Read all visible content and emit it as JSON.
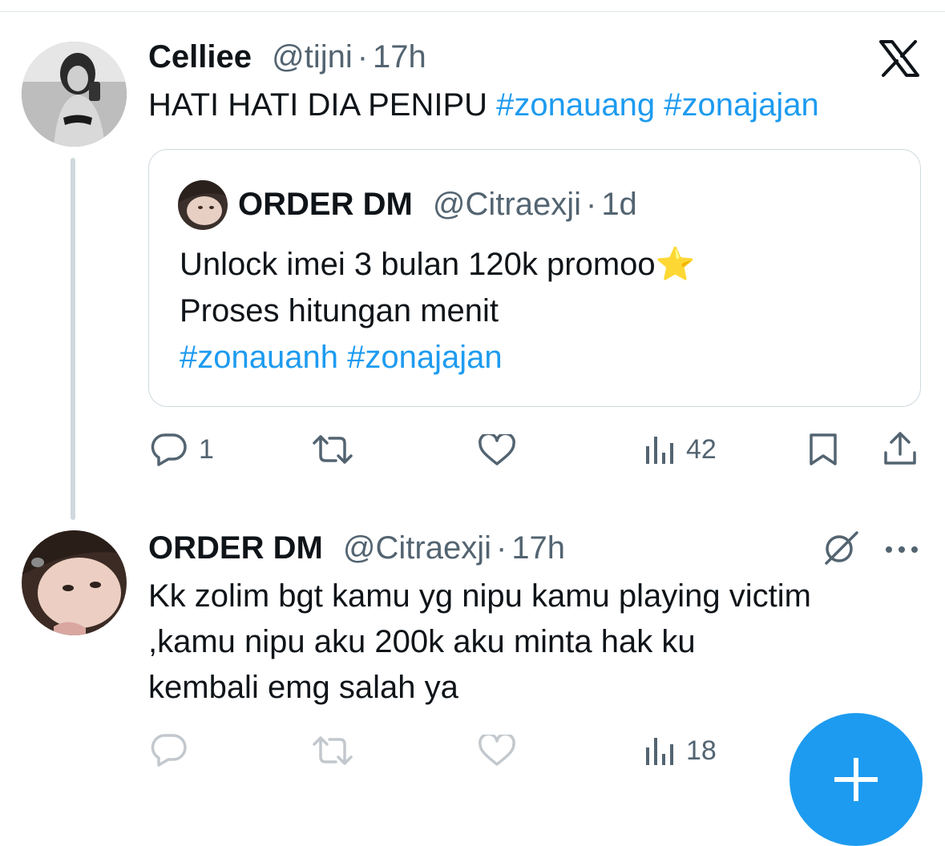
{
  "tweet": {
    "author_name": "Celliee",
    "author_handle": "@tijni",
    "separator": "·",
    "time": "17h",
    "text_plain": "HATI HATI DIA PENIPU",
    "hashtags": [
      "#zonauang",
      "#zonajajan"
    ],
    "platform_icon": "x-logo-icon"
  },
  "quoted": {
    "author_name": "ORDER DM",
    "author_handle": "@Citraexji",
    "separator": "·",
    "time": "1d",
    "line1": "Unlock imei 3 bulan 120k promoo",
    "line1_emoji": "⭐",
    "line2": "Proses hitungan menit",
    "hashtags": [
      "#zonauanh",
      "#zonajajan"
    ]
  },
  "tweet_actions": {
    "reply_count": "1",
    "retweet_count": "",
    "like_count": "",
    "views_count": "42"
  },
  "reply": {
    "author_name": "ORDER DM",
    "author_handle": "@Citraexji",
    "separator": "·",
    "time": "17h",
    "lines": [
      "Kk zolim bgt kamu yg nipu kamu playing victim",
      ",kamu nipu aku 200k aku minta hak ku",
      "kembali emg salah ya"
    ]
  },
  "reply_actions": {
    "views_count": "18"
  },
  "colors": {
    "accent": "#1d9bf0",
    "text": "#0f1419",
    "secondary": "#536471",
    "border": "#cfd9de"
  }
}
